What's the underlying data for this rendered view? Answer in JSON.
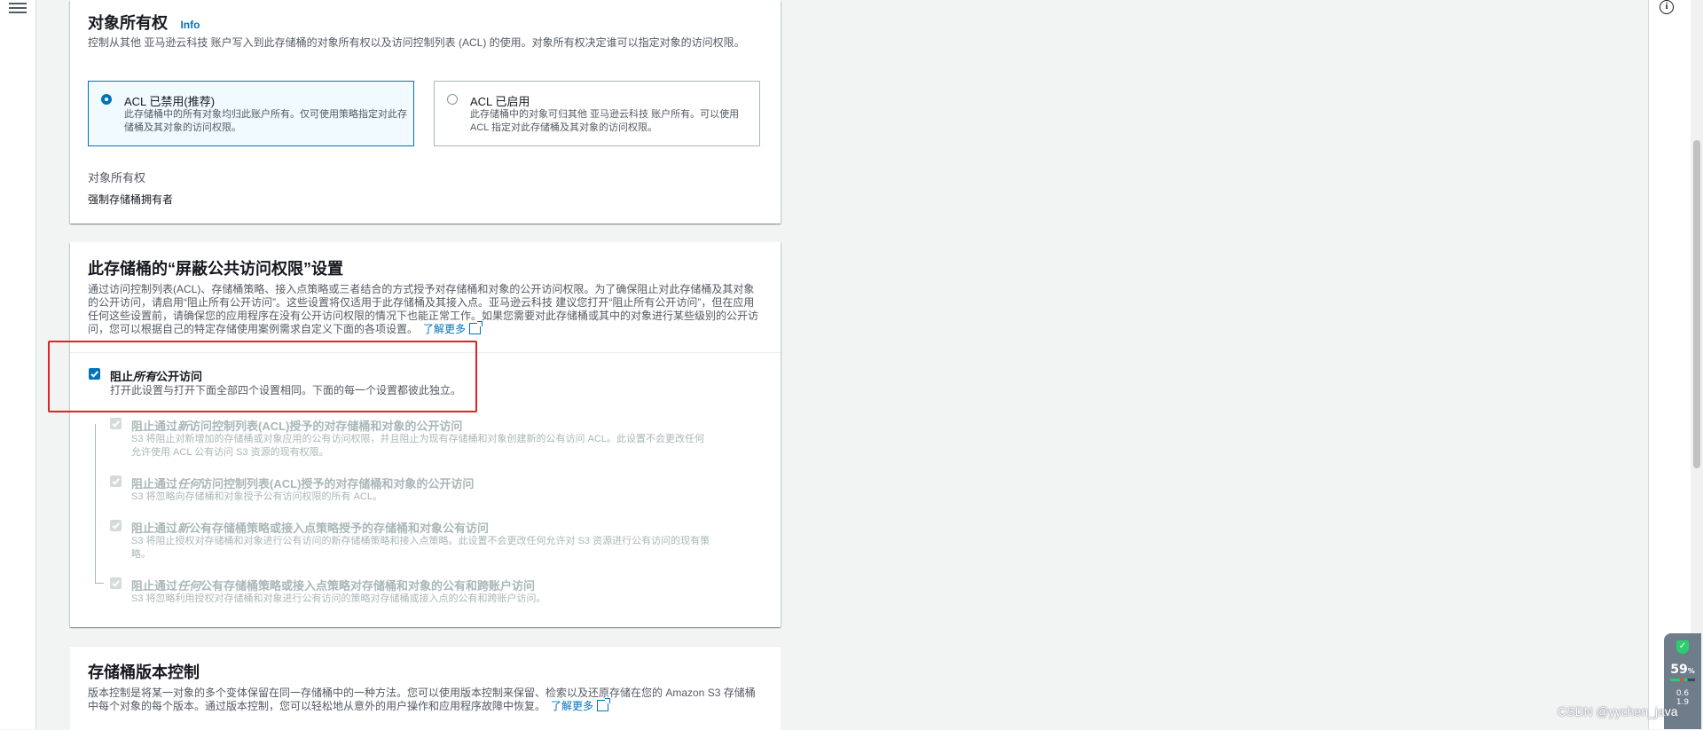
{
  "object_ownership": {
    "title": "对象所有权",
    "info_link": "Info",
    "description": "控制从其他 亚马逊云科技 账户写入到此存储桶的对象所有权以及访问控制列表 (ACL) 的使用。对象所有权决定谁可以指定对象的访问权限。",
    "options": [
      {
        "label": "ACL 已禁用(推荐)",
        "description": "此存储桶中的所有对象均归此账户所有。仅可使用策略指定对此存储桶及其对象的访问权限。",
        "selected": true
      },
      {
        "label": "ACL 已启用",
        "description": "此存储桶中的对象可归其他 亚马逊云科技 账户所有。可以使用 ACL 指定对此存储桶及其对象的访问权限。",
        "selected": false
      }
    ],
    "ownership_label": "对象所有权",
    "ownership_value": "强制存储桶拥有者"
  },
  "block_public_access": {
    "title": "此存储桶的“屏蔽公共访问权限”设置",
    "description_lines": [
      "通过访问控制列表(ACL)、存储桶策略、接入点策略或三者结合的方式授予对存储桶和对象的公开访问权限。为了确保阻止对此存储桶及其对象",
      "的公开访问，请启用“阻止所有公开访问”。这些设置将仅适用于此存储桶及其接入点。亚马逊云科技 建议您打开“阻止所有公开访问”，但在应用",
      "任何这些设置前，请确保您的应用程序在没有公开访问权限的情况下也能正常工作。如果您需要对此存储桶或其中的对象进行某些级别的公开访",
      "问，您可以根据自己的特定存储使用案例需求自定义下面的各项设置。"
    ],
    "learn_more": "了解更多",
    "block_all": {
      "title_prefix": "阻止",
      "title_emph": "所有",
      "title_suffix": "公开访问",
      "description": "打开此设置与打开下面全部四个设置相同。下面的每一个设置都彼此独立。",
      "checked": true
    },
    "sub_options": [
      {
        "prefix": "阻止通过",
        "emph": "新",
        "suffix": "访问控制列表(ACL)授予的对存储桶和对象的公开访问",
        "desc_lines": [
          "S3 将阻止对新增加的存储桶或对象应用的公有访问权限，并且阻止为现有存储桶和对象创建新的公有访问 ACL。此设置不会更改任何",
          "允许使用 ACL 公有访问 S3 资源的现有权限。"
        ],
        "checked": true
      },
      {
        "prefix": "阻止通过",
        "emph": "任何",
        "suffix": "访问控制列表(ACL)授予的对存储桶和对象的公开访问",
        "desc_lines": [
          "S3 将忽略向存储桶和对象授予公有访问权限的所有 ACL。"
        ],
        "checked": true
      },
      {
        "prefix": "阻止通过",
        "emph": "新",
        "suffix": "公有存储桶策略或接入点策略授予的存储桶和对象公有访问",
        "desc_lines": [
          "S3 将阻止授权对存储桶和对象进行公有访问的新存储桶策略和接入点策略。此设置不会更改任何允许对 S3 资源进行公有访问的现有策",
          "略。"
        ],
        "checked": true
      },
      {
        "prefix": "阻止通过",
        "emph": "任何",
        "suffix": "公有存储桶策略或接入点策略对存储桶和对象的公有和跨账户访问",
        "desc_lines": [
          "S3 将忽略利用授权对存储桶和对象进行公有访问的策略对存储桶或接入点的公有和跨账户访问。"
        ],
        "checked": true
      }
    ]
  },
  "versioning": {
    "title": "存储桶版本控制",
    "description_lines": [
      "版本控制是将某一对象的多个变体保留在同一存储桶中的一种方法。您可以使用版本控制来保留、检索以及还原存储在您的 Amazon S3 存储桶",
      "中每个对象的每个版本。通过版本控制，您可以轻松地从意外的用户操作和应用程序故障中恢复。"
    ],
    "learn_more": "了解更多"
  },
  "monitor": {
    "percent": "59",
    "percent_unit": "%",
    "net_up": "0.6",
    "net_down": "1.9"
  },
  "watermark": "CSDN @yychen_java",
  "colors": {
    "accent": "#0073bb",
    "highlight": "#e0222a",
    "background": "#f2f3f3"
  }
}
